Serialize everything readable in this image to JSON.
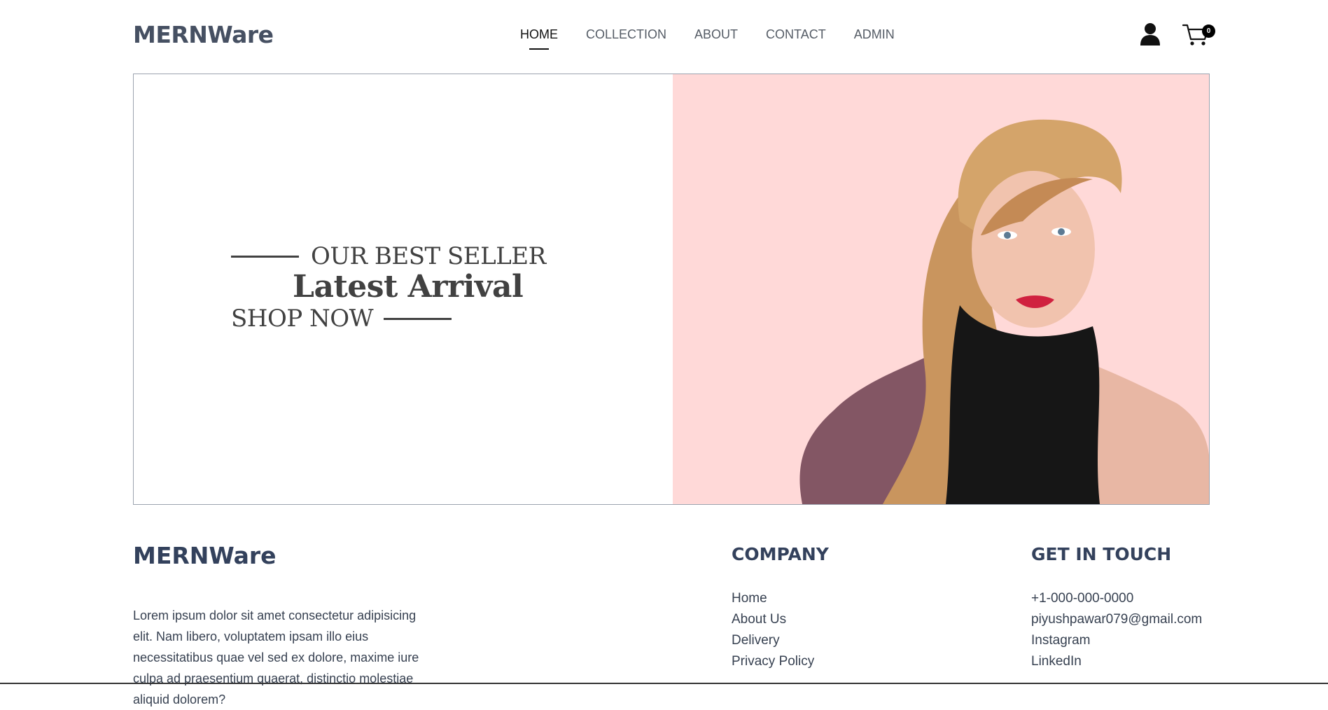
{
  "header": {
    "logo": "MERNWare",
    "nav": [
      "HOME",
      "COLLECTION",
      "ABOUT",
      "CONTACT",
      "ADMIN"
    ],
    "cart_count": "0"
  },
  "hero": {
    "bestseller": "OUR BEST SELLER",
    "title": "Latest Arrival",
    "cta": "SHOP NOW",
    "bg_color": "#ffd9d8"
  },
  "footer": {
    "logo": "MERNWare",
    "description": "Lorem ipsum dolor sit amet consectetur adipisicing elit. Nam libero, voluptatem ipsam illo eius necessitatibus quae vel sed ex dolore, maxime iure culpa ad praesentium quaerat, distinctio molestiae aliquid dolorem?",
    "company": {
      "title": "COMPANY",
      "links": [
        "Home",
        "About Us",
        "Delivery",
        "Privacy Policy"
      ]
    },
    "contact": {
      "title": "GET IN TOUCH",
      "items": [
        "+1-000-000-0000",
        "piyushpawar079@gmail.com",
        "Instagram",
        "LinkedIn"
      ]
    }
  }
}
